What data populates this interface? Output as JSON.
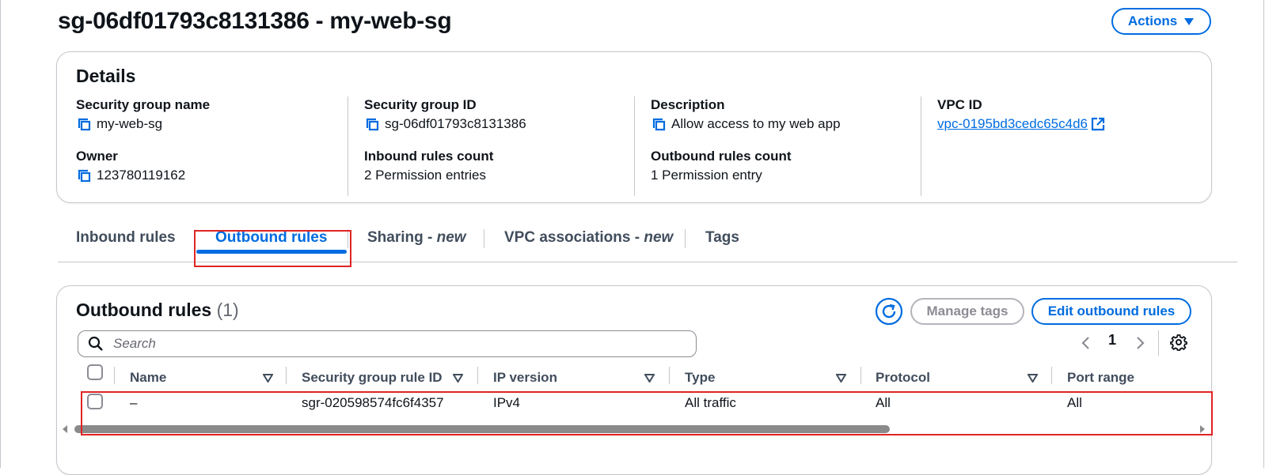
{
  "header": {
    "title": "sg-06df01793c8131386 - my-web-sg",
    "actions_label": "Actions"
  },
  "details": {
    "title": "Details",
    "security_group_name": {
      "label": "Security group name",
      "value": "my-web-sg"
    },
    "security_group_id": {
      "label": "Security group ID",
      "value": "sg-06df01793c8131386"
    },
    "description": {
      "label": "Description",
      "value": "Allow access to my web app"
    },
    "vpc_id": {
      "label": "VPC ID",
      "value": "vpc-0195bd3cedc65c4d6"
    },
    "owner": {
      "label": "Owner",
      "value": "123780119162"
    },
    "inbound_count": {
      "label": "Inbound rules count",
      "value": "2 Permission entries"
    },
    "outbound_count": {
      "label": "Outbound rules count",
      "value": "1 Permission entry"
    }
  },
  "tabs": [
    {
      "label": "Inbound rules",
      "suffix": ""
    },
    {
      "label": "Outbound rules",
      "suffix": ""
    },
    {
      "label": "Sharing - ",
      "suffix": "new"
    },
    {
      "label": "VPC associations - ",
      "suffix": "new"
    },
    {
      "label": "Tags",
      "suffix": ""
    }
  ],
  "rules_panel": {
    "title": "Outbound rules",
    "count": "(1)",
    "manage_tags_label": "Manage tags",
    "edit_label": "Edit outbound rules",
    "search_placeholder": "Search",
    "current_page": "1",
    "columns": [
      "Name",
      "Security group rule ID",
      "IP version",
      "Type",
      "Protocol",
      "Port range"
    ],
    "rows": [
      {
        "name": "–",
        "rule_id": "sgr-020598574fc6f4357",
        "ip_version": "IPv4",
        "type": "All traffic",
        "protocol": "All",
        "port_range": "All"
      }
    ]
  },
  "colors": {
    "accent": "#006ce0",
    "highlight_box": "#e02424",
    "border": "#c6c6cd"
  },
  "icons": [
    "copy-icon",
    "external-link-icon",
    "caret-down-icon",
    "refresh-icon",
    "search-icon",
    "chevron-left-icon",
    "chevron-right-icon",
    "settings-gear-icon",
    "sort-caret-icon"
  ]
}
